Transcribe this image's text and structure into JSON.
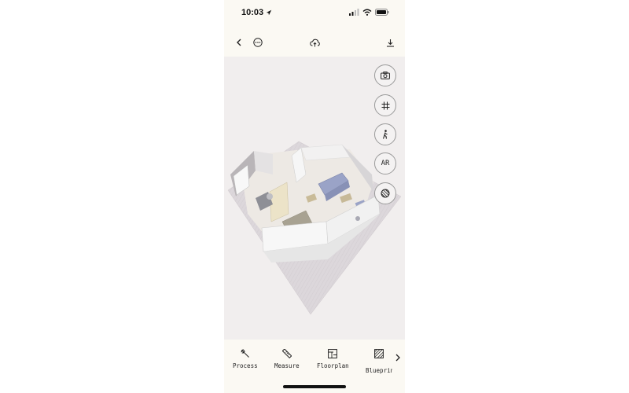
{
  "status_bar": {
    "time": "10:03"
  },
  "toolbar": {
    "icons": [
      "back-chevron-icon",
      "more-options-icon",
      "cloud-upload-icon",
      "download-icon"
    ]
  },
  "side_buttons": {
    "camera_icon": "camera-icon",
    "grid_icon": "grid-icon",
    "walk_icon": "walk-person-icon",
    "ar_label": "AR",
    "texture_icon": "texture-sphere-icon"
  },
  "bottom_tabs": [
    {
      "label": "Process",
      "icon": "wrench-icon"
    },
    {
      "label": "Measure",
      "icon": "ruler-icon"
    },
    {
      "label": "Floorplan",
      "icon": "floorplan-icon"
    },
    {
      "label": "Blueprint",
      "icon": "blueprint-icon"
    }
  ],
  "colors": {
    "bar_bg": "#fbf9f3",
    "canvas_bg": "#f1eeee",
    "sofa": "#9aa3c7",
    "floor": "#d9d4d8"
  }
}
